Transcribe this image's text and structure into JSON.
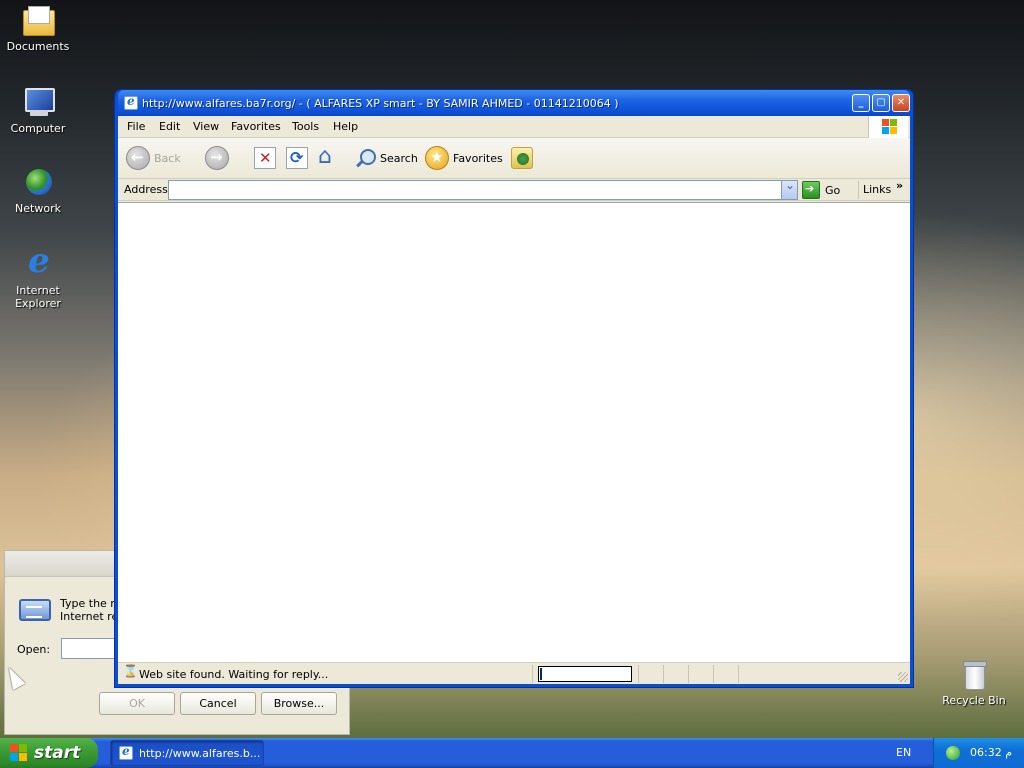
{
  "desktop": {
    "icons": [
      {
        "label": "Documents"
      },
      {
        "label": "Computer"
      },
      {
        "label": "Network"
      },
      {
        "label_line1": "Internet",
        "label_line2": "Explorer"
      },
      {
        "label": "Recycle Bin"
      }
    ]
  },
  "run_dialog": {
    "description_line1": "Type the na",
    "description_line2": "Internet re",
    "open_label": "Open:",
    "open_value": "",
    "ok_label": "OK",
    "cancel_label": "Cancel",
    "browse_label": "Browse..."
  },
  "ie_window": {
    "title": "http://www.alfares.ba7r.org/ - ( ALFARES XP smart  -  BY SAMIR AHMED - 01141210064 )",
    "menu": [
      "File",
      "Edit",
      "View",
      "Favorites",
      "Tools",
      "Help"
    ],
    "toolbar": {
      "back_label": "Back",
      "search_label": "Search",
      "favorites_label": "Favorites"
    },
    "address": {
      "label": "Address",
      "value": "",
      "go_label": "Go",
      "links_label": "Links",
      "links_more": "»"
    },
    "status": {
      "text": "Web site found. Waiting for reply...",
      "progress": 0.02
    }
  },
  "taskbar": {
    "start_label": "start",
    "task_item_label": "http://www.alfares.b...",
    "language": "EN",
    "clock": "06:32 م"
  },
  "colors": {
    "xp_blue": "#0a4fd0",
    "start_green": "#3c9a35",
    "window_face": "#ece9d8"
  }
}
